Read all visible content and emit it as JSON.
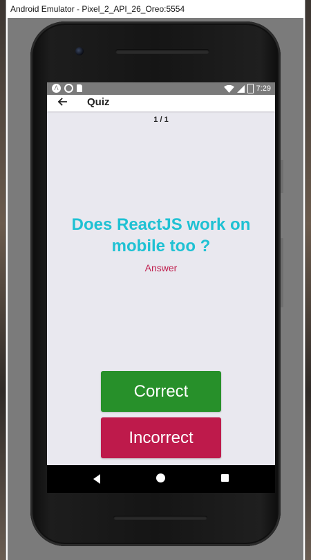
{
  "window": {
    "title": "Android Emulator - Pixel_2_API_26_Oreo:5554"
  },
  "status_bar": {
    "left_icons": [
      "android-notification-icon",
      "circle-notification-icon",
      "sd-card-icon"
    ],
    "right_icons": [
      "wifi-icon",
      "cell-signal-icon",
      "battery-icon"
    ],
    "time": "7:29"
  },
  "app_bar": {
    "back_icon": "arrow-left-icon",
    "title": "Quiz"
  },
  "quiz": {
    "progress": "1 / 1",
    "question": "Does ReactJS work on mobile too ?",
    "answer_label": "Answer",
    "correct_label": "Correct",
    "incorrect_label": "Incorrect"
  },
  "nav_bar": {
    "icons": [
      "back-triangle-icon",
      "home-circle-icon",
      "recents-square-icon"
    ]
  },
  "colors": {
    "question": "#1fc1d3",
    "answer_label": "#c0204f",
    "correct_button": "#27902a",
    "incorrect_button": "#be1a4b",
    "screen_background": "#e9e8ef",
    "status_bar": "#7a7a7a"
  }
}
